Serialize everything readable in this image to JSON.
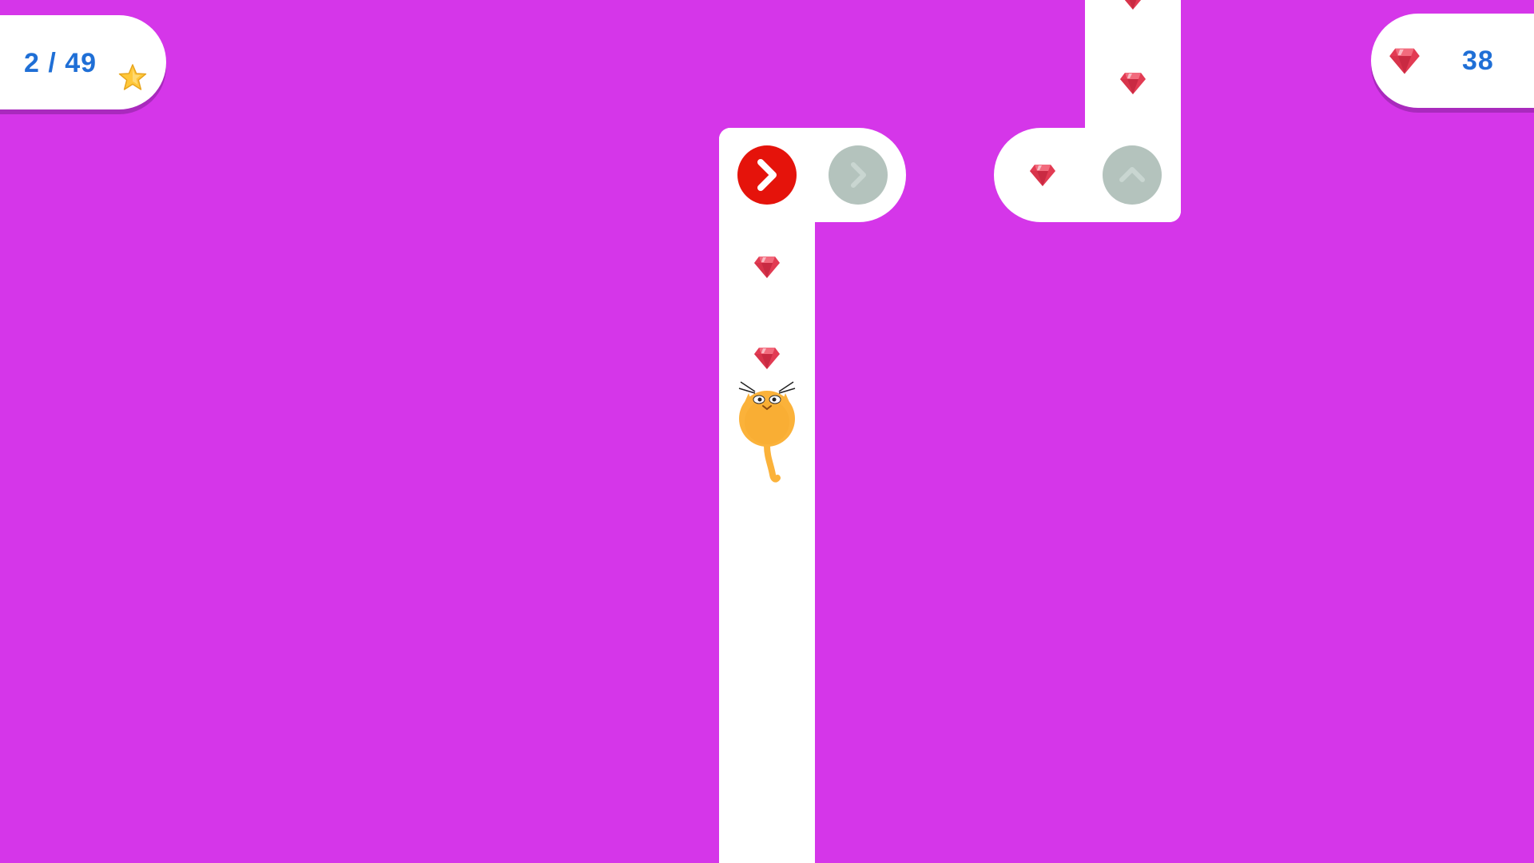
{
  "colors": {
    "background": "#d536e9",
    "path": "#ffffff",
    "hud_text": "#1f6fd6",
    "active_arrow": "#e5130b",
    "inactive_arrow": "#b4c3bd",
    "gem": "#e23b53",
    "star": "#ffc83a",
    "cat": "#fbb23a"
  },
  "hud": {
    "level_progress": "2 / 49",
    "level_icon": "star-icon",
    "gem_icon": "gem-icon",
    "gem_count": "38"
  },
  "board": {
    "arrow_buttons": [
      {
        "direction": "right",
        "state": "active",
        "icon": "chevron-right-icon"
      },
      {
        "direction": "right",
        "state": "inactive",
        "icon": "chevron-right-icon"
      },
      {
        "direction": "up",
        "state": "inactive",
        "icon": "chevron-up-icon"
      }
    ],
    "gems_on_path": 5,
    "player": "cat"
  }
}
